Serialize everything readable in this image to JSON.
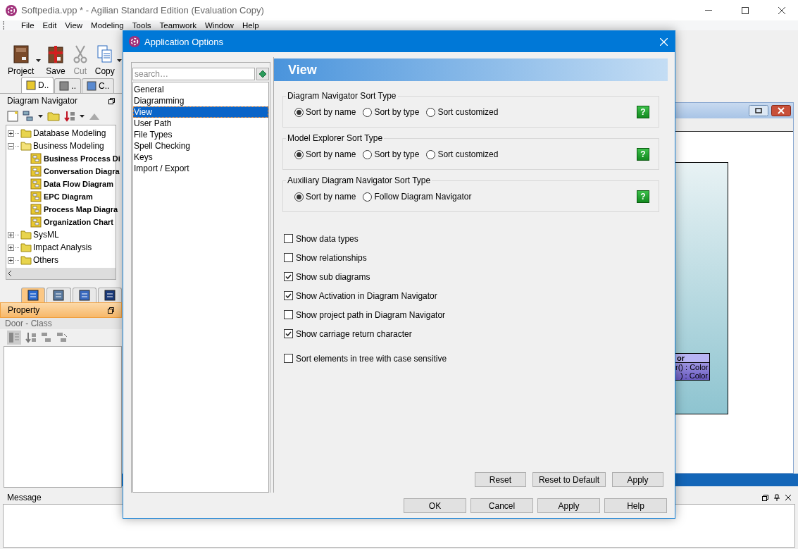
{
  "window": {
    "title": "Softpedia.vpp * - Agilian Standard Edition (Evaluation Copy)"
  },
  "menu": [
    "File",
    "Edit",
    "View",
    "Modeling",
    "Tools",
    "Teamwork",
    "Window",
    "Help"
  ],
  "toolbar": [
    {
      "label": "Project",
      "kind": "book",
      "dropdown": true,
      "disabled": false
    },
    {
      "label": "Save",
      "kind": "gift",
      "dropdown": false,
      "disabled": false
    },
    {
      "label": "Cut",
      "kind": "scissors",
      "dropdown": false,
      "disabled": true
    },
    {
      "label": "Copy",
      "kind": "pages",
      "dropdown": true,
      "disabled": false
    }
  ],
  "panel_tabs": [
    {
      "label": "D..",
      "selected": true
    },
    {
      "label": "..",
      "selected": false
    },
    {
      "label": "C..",
      "selected": false
    }
  ],
  "navigator": {
    "title": "Diagram Navigator",
    "tree": [
      {
        "label": "Database Modeling",
        "expanded": false
      },
      {
        "label": "Business Modeling",
        "expanded": true,
        "children": [
          {
            "label": "Business Process Di"
          },
          {
            "label": "Conversation Diagra"
          },
          {
            "label": "Data Flow Diagram"
          },
          {
            "label": "EPC Diagram"
          },
          {
            "label": "Process Map Diagra"
          },
          {
            "label": "Organization Chart"
          }
        ]
      },
      {
        "label": "SysML",
        "expanded": false
      },
      {
        "label": "Impact Analysis",
        "expanded": false
      },
      {
        "label": "Others",
        "expanded": false
      }
    ]
  },
  "property_tabs": [
    {
      "selected": true
    },
    {
      "selected": false
    },
    {
      "selected": false
    },
    {
      "selected": false
    }
  ],
  "property": {
    "title": "Property",
    "subtitle": "Door - Class"
  },
  "diagram": {
    "class_name": "or",
    "operations": [
      "r() : Color",
      ") : Color"
    ]
  },
  "message": {
    "title": "Message"
  },
  "dialog": {
    "title": "Application Options",
    "search": {
      "placeholder": "search…"
    },
    "categories": [
      {
        "label": "General",
        "selected": false
      },
      {
        "label": "Diagramming",
        "selected": false
      },
      {
        "label": "View",
        "selected": true
      },
      {
        "label": "User Path",
        "selected": false
      },
      {
        "label": "File Types",
        "selected": false
      },
      {
        "label": "Spell Checking",
        "selected": false
      },
      {
        "label": "Keys",
        "selected": false
      },
      {
        "label": "Import / Export",
        "selected": false
      }
    ],
    "page_title": "View",
    "groups": [
      {
        "title": "Diagram Navigator Sort Type",
        "help": "?",
        "options": [
          {
            "label": "Sort by name",
            "selected": true
          },
          {
            "label": "Sort by type",
            "selected": false
          },
          {
            "label": "Sort customized",
            "selected": false
          }
        ]
      },
      {
        "title": "Model Explorer Sort Type",
        "help": "?",
        "options": [
          {
            "label": "Sort by name",
            "selected": true
          },
          {
            "label": "Sort by type",
            "selected": false
          },
          {
            "label": "Sort customized",
            "selected": false
          }
        ]
      },
      {
        "title": "Auxiliary Diagram Navigator Sort Type",
        "help": "?",
        "options": [
          {
            "label": "Sort by name",
            "selected": true
          },
          {
            "label": "Follow Diagram Navigator",
            "selected": false
          }
        ]
      }
    ],
    "checkboxes": [
      {
        "label": "Show data types",
        "checked": false
      },
      {
        "label": "Show relationships",
        "checked": false
      },
      {
        "label": "Show sub diagrams",
        "checked": true
      },
      {
        "label": "Show Activation in Diagram Navigator",
        "checked": true
      },
      {
        "label": "Show project path in Diagram Navigator",
        "checked": false
      },
      {
        "label": "Show carriage return character",
        "checked": true
      },
      {
        "label": "Sort elements in tree with case sensitive",
        "checked": false
      }
    ],
    "page_buttons": [
      "Reset",
      "Reset to Default",
      "Apply"
    ],
    "buttons": [
      "OK",
      "Cancel",
      "Apply",
      "Help"
    ]
  }
}
